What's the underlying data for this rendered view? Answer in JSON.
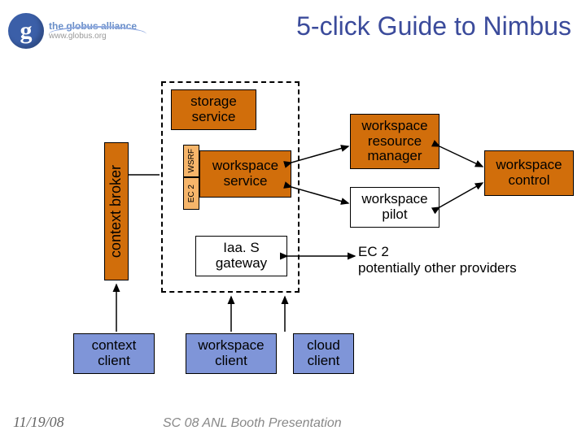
{
  "header": {
    "logo_letter": "g",
    "logo_line1": "the globus alliance",
    "logo_line2": "www.globus.org",
    "title": "5-click Guide to Nimbus"
  },
  "boxes": {
    "storage_service": "storage\nservice",
    "workspace_service": "workspace\nservice",
    "iaas_gateway": "Iaa. S\ngateway",
    "context_broker": "context broker",
    "ec2": "EC 2",
    "wsrf": "WSRF",
    "workspace_resource_manager": "workspace\nresource\nmanager",
    "workspace_pilot": "workspace\npilot",
    "workspace_control": "workspace\ncontrol",
    "context_client": "context\nclient",
    "workspace_client": "workspace\nclient",
    "cloud_client": "cloud\nclient"
  },
  "notes": {
    "ec2_line1": "EC 2",
    "ec2_line2": "potentially other providers"
  },
  "footer": {
    "date": "11/19/08",
    "caption": "SC 08 ANL Booth Presentation"
  }
}
